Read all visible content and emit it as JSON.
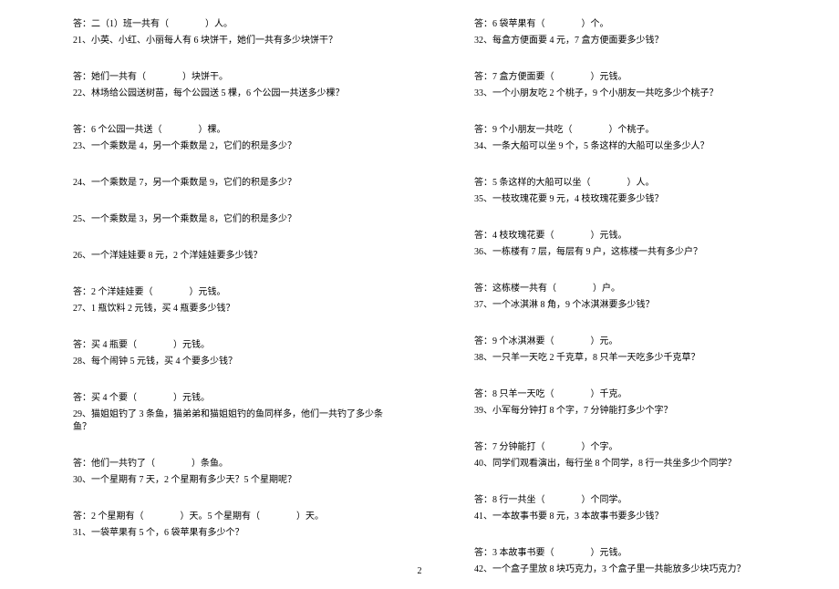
{
  "left": [
    "答：二（1）班一共有（　　　　）人。",
    "21、小英、小红、小丽每人有 6 块饼干，她们一共有多少块饼干？",
    "",
    "答：她们一共有（　　　　）块饼干。",
    "22、林场给公园送树苗，每个公园送 5 棵，6 个公园一共送多少棵？",
    "",
    "答：6 个公园一共送（　　　　）棵。",
    "23、一个乘数是 4，另一个乘数是 2，它们的积是多少？",
    "",
    "24、一个乘数是 7，另一个乘数是 9，它们的积是多少？",
    "",
    "25、一个乘数是 3，另一个乘数是 8，它们的积是多少？",
    "",
    "26、一个洋娃娃要 8 元，2 个洋娃娃要多少钱？",
    "",
    "答：2 个洋娃娃要（　　　　）元钱。",
    "27、1 瓶饮料 2 元钱，买 4 瓶要多少钱？",
    "",
    "答：买 4 瓶要（　　　　）元钱。",
    "28、每个闹钟 5 元钱，买 4 个要多少钱？",
    "",
    "答：买 4 个要（　　　　）元钱。",
    "29、猫姐姐钓了 3 条鱼，猫弟弟和猫姐姐钓的鱼同样多，他们一共钓了多少条鱼？",
    "",
    "答：他们一共钓了（　　　　）条鱼。",
    "30、一个星期有 7 天，2 个星期有多少天？5 个星期呢？",
    "",
    "答：2 个星期有（　　　　）天。5 个星期有（　　　　）天。",
    "31、一袋苹果有 5 个，6 袋苹果有多少个？"
  ],
  "right": [
    "答：6 袋苹果有（　　　　）个。",
    "32、每盒方便面要 4 元，7 盒方便面要多少钱？",
    "",
    "答：7 盒方便面要（　　　　）元钱。",
    "33、一个小朋友吃 2 个桃子，9 个小朋友一共吃多少个桃子？",
    "",
    "答：9 个小朋友一共吃（　　　　）个桃子。",
    "34、一条大船可以坐 9 个，5 条这样的大船可以坐多少人？",
    "",
    "答：5 条这样的大船可以坐（　　　　）人。",
    "35、一枝玫瑰花要 9 元，4 枝玫瑰花要多少钱？",
    "",
    "答：4 枝玫瑰花要（　　　　）元钱。",
    "36、一栋楼有 7 层，每层有 9 户，这栋楼一共有多少户？",
    "",
    "答：这栋楼一共有（　　　　）户。",
    "37、一个冰淇淋 8 角，9 个冰淇淋要多少钱？",
    "",
    "答：9 个冰淇淋要（　　　　）元。",
    "38、一只羊一天吃 2 千克草，8 只羊一天吃多少千克草？",
    "",
    "答：8 只羊一天吃（　　　　）千克。",
    "39、小军每分钟打 8 个字，7 分钟能打多少个字？",
    "",
    "答：7 分钟能打（　　　　）个字。",
    "40、同学们观看演出，每行坐 8 个同学，8 行一共坐多少个同学？",
    "",
    "答：8 行一共坐（　　　　）个同学。",
    "41、一本故事书要 8 元，3 本故事书要多少钱？",
    "",
    "答：3 本故事书要（　　　　）元钱。",
    "42、一个盒子里放 8 块巧克力，3 个盒子里一共能放多少块巧克力？"
  ],
  "pageNumber": "2"
}
